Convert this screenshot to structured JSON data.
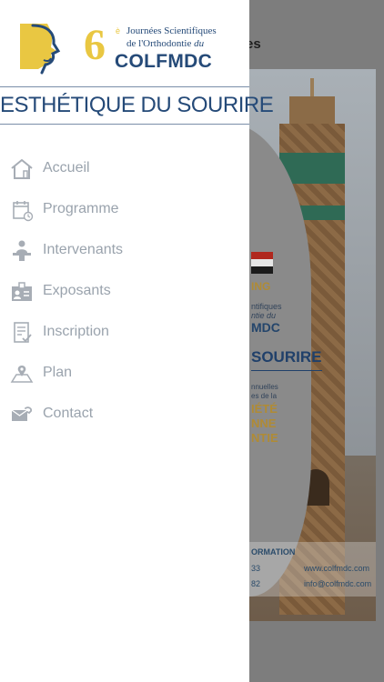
{
  "background": {
    "title_fragment": "es",
    "poster": {
      "heading_fragment": "ING",
      "subtitle_line1": "ntifiques",
      "subtitle_line2": "ntie du",
      "brand_fragment": "MDC",
      "theme_fragment": "SOURIRE",
      "annual_line1": "nnuelles",
      "annual_line2": "es de la",
      "society_line1": "IÉTÉ",
      "society_line2": "NNE",
      "society_line3": "NTIE",
      "info_label": "ORMATION",
      "phone1_fragment": "33",
      "phone2_fragment": "82",
      "website": "www.colfmdc.com",
      "email": "info@colfmdc.com"
    }
  },
  "drawer": {
    "logo": {
      "edition_number": "6",
      "edition_suffix": "è",
      "line1": "Journées Scientifiques",
      "line2_prefix": "de l'Orthodontie ",
      "line2_italic": "du",
      "brand": "COLFMDC"
    },
    "banner": "ESTHÉTIQUE DU SOURIRE",
    "menu": [
      {
        "label": "Accueil",
        "icon": "home-icon"
      },
      {
        "label": "Programme",
        "icon": "calendar-icon"
      },
      {
        "label": "Intervenants",
        "icon": "speaker-icon"
      },
      {
        "label": "Exposants",
        "icon": "exhibitor-badge-icon"
      },
      {
        "label": "Inscription",
        "icon": "registration-form-icon"
      },
      {
        "label": "Plan",
        "icon": "map-pin-icon"
      },
      {
        "label": "Contact",
        "icon": "contact-icon"
      }
    ]
  },
  "colors": {
    "brand_blue": "#254a78",
    "brand_gold": "#e9c742",
    "menu_text": "#9aa3ad",
    "menu_icon": "#a7adb5",
    "overlay": "#7d7d7d"
  }
}
